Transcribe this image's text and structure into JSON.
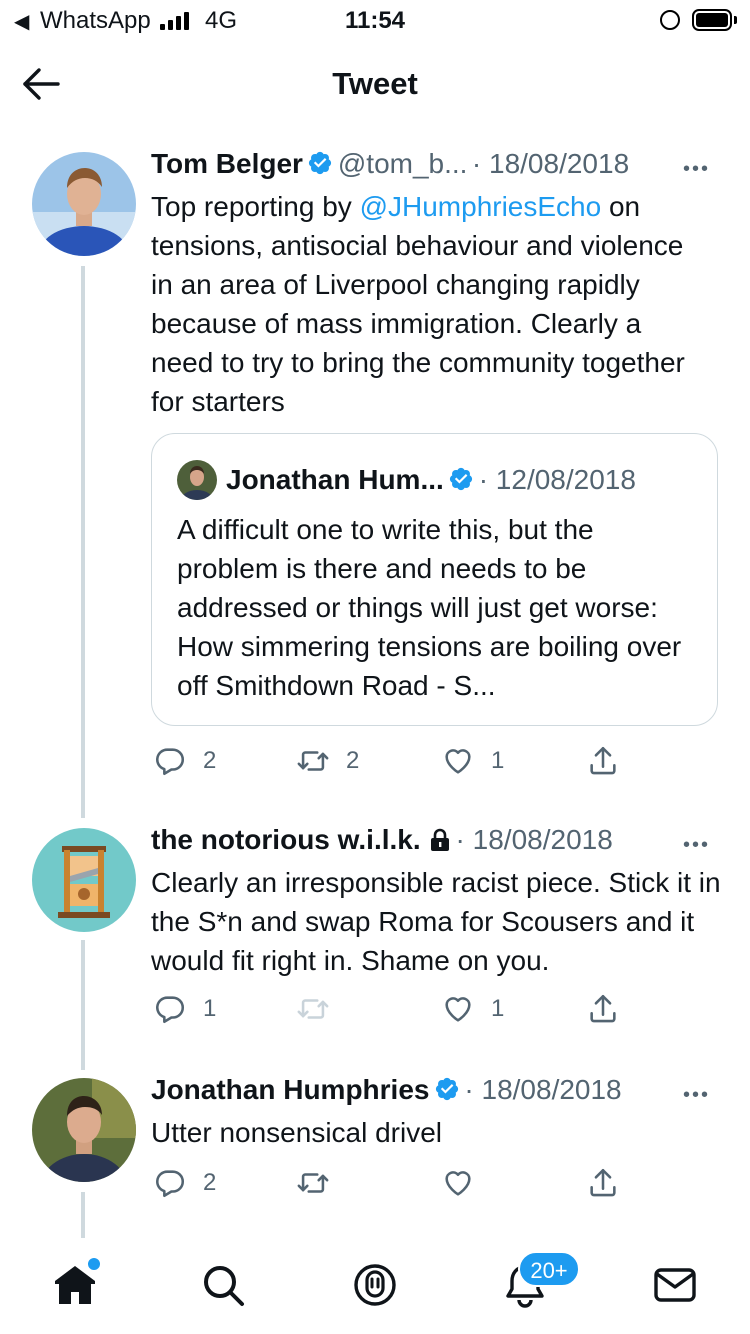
{
  "status_bar": {
    "back_label": "◀",
    "app": "WhatsApp",
    "network": "4G",
    "time": "11:54"
  },
  "header": {
    "title": "Tweet"
  },
  "tweets": [
    {
      "name": "Tom Belger",
      "handle": "@tom_b...",
      "date": "· 18/08/2018",
      "more": "•••",
      "text_before": "Top reporting by ",
      "mention": "@JHumphriesEcho",
      "text_after": " on tensions, antisocial behaviour and violence in an area of Liverpool changing rapidly because of mass immigration. Clearly a need to try to bring the community together for starters",
      "quote": {
        "name": "Jonathan Hum...",
        "date": "· 12/08/2018",
        "text": "A difficult one to write this, but the problem is there and needs to be addressed or things will just get worse: How simmering tensions are boiling over off Smithdown Road - S..."
      },
      "replies": "2",
      "retweets": "2",
      "likes": "1"
    },
    {
      "name": "the notorious w.i.l.k.",
      "date": "· 18/08/2018",
      "more": "•••",
      "text": "Clearly an irresponsible racist piece. Stick it in the S*n and swap Roma for Scousers and it would fit right in. Shame on you.",
      "replies": "1",
      "likes": "1"
    },
    {
      "name": "Jonathan Humphries",
      "date": "· 18/08/2018",
      "more": "•••",
      "text": "Utter nonsensical drivel",
      "replies": "2"
    }
  ],
  "tabbar": {
    "notifications_badge": "20+"
  },
  "colors": {
    "accent": "#1d9bf0",
    "muted": "#536471",
    "divider": "#cfd9de"
  },
  "icons": [
    "back-arrow-icon",
    "verified-badge-icon",
    "lock-icon",
    "reply-icon",
    "retweet-icon",
    "like-icon",
    "share-icon",
    "home-icon",
    "search-icon",
    "spaces-icon",
    "notifications-icon",
    "messages-icon"
  ]
}
